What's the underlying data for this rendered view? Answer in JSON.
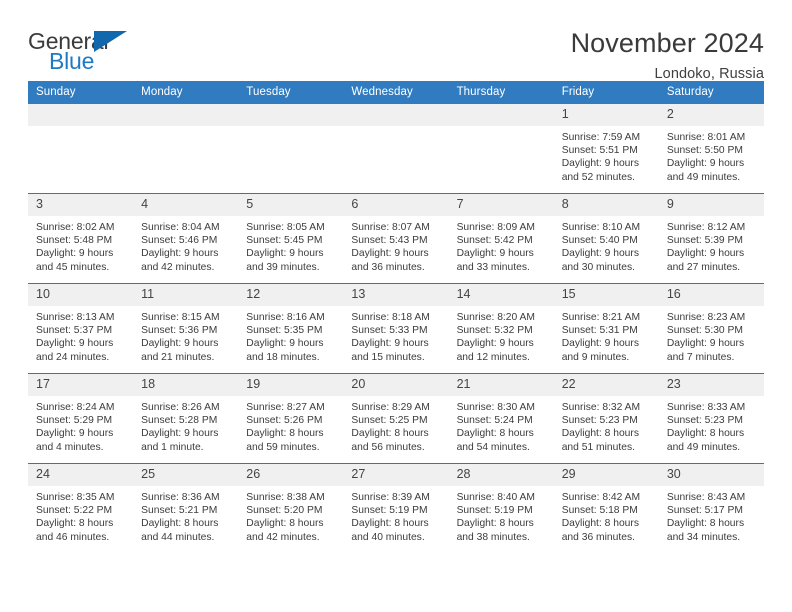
{
  "logo": {
    "word_one": "General",
    "word_two": "Blue",
    "flag_icon": "triangle-flag-icon"
  },
  "header": {
    "title": "November 2024",
    "location": "Londoko, Russia"
  },
  "colors": {
    "header_blue": "#317cc0",
    "row_divider": "#2f78ba",
    "daynum_band": "#f0f0f0",
    "logo_blue": "#1f7ac4",
    "text": "#3c3c3c"
  },
  "calendar": {
    "weekday_headers": [
      "Sunday",
      "Monday",
      "Tuesday",
      "Wednesday",
      "Thursday",
      "Friday",
      "Saturday"
    ],
    "labels": {
      "sunrise_prefix": "Sunrise:",
      "sunset_prefix": "Sunset:",
      "daylight_prefix": "Daylight:"
    },
    "weeks": [
      [
        {
          "day": "",
          "empty": true
        },
        {
          "day": "",
          "empty": true
        },
        {
          "day": "",
          "empty": true
        },
        {
          "day": "",
          "empty": true
        },
        {
          "day": "",
          "empty": true
        },
        {
          "day": "1",
          "sunrise": "Sunrise: 7:59 AM",
          "sunset": "Sunset: 5:51 PM",
          "daylight_line1": "Daylight: 9 hours",
          "daylight_line2": "and 52 minutes."
        },
        {
          "day": "2",
          "sunrise": "Sunrise: 8:01 AM",
          "sunset": "Sunset: 5:50 PM",
          "daylight_line1": "Daylight: 9 hours",
          "daylight_line2": "and 49 minutes."
        }
      ],
      [
        {
          "day": "3",
          "sunrise": "Sunrise: 8:02 AM",
          "sunset": "Sunset: 5:48 PM",
          "daylight_line1": "Daylight: 9 hours",
          "daylight_line2": "and 45 minutes."
        },
        {
          "day": "4",
          "sunrise": "Sunrise: 8:04 AM",
          "sunset": "Sunset: 5:46 PM",
          "daylight_line1": "Daylight: 9 hours",
          "daylight_line2": "and 42 minutes."
        },
        {
          "day": "5",
          "sunrise": "Sunrise: 8:05 AM",
          "sunset": "Sunset: 5:45 PM",
          "daylight_line1": "Daylight: 9 hours",
          "daylight_line2": "and 39 minutes."
        },
        {
          "day": "6",
          "sunrise": "Sunrise: 8:07 AM",
          "sunset": "Sunset: 5:43 PM",
          "daylight_line1": "Daylight: 9 hours",
          "daylight_line2": "and 36 minutes."
        },
        {
          "day": "7",
          "sunrise": "Sunrise: 8:09 AM",
          "sunset": "Sunset: 5:42 PM",
          "daylight_line1": "Daylight: 9 hours",
          "daylight_line2": "and 33 minutes."
        },
        {
          "day": "8",
          "sunrise": "Sunrise: 8:10 AM",
          "sunset": "Sunset: 5:40 PM",
          "daylight_line1": "Daylight: 9 hours",
          "daylight_line2": "and 30 minutes."
        },
        {
          "day": "9",
          "sunrise": "Sunrise: 8:12 AM",
          "sunset": "Sunset: 5:39 PM",
          "daylight_line1": "Daylight: 9 hours",
          "daylight_line2": "and 27 minutes."
        }
      ],
      [
        {
          "day": "10",
          "sunrise": "Sunrise: 8:13 AM",
          "sunset": "Sunset: 5:37 PM",
          "daylight_line1": "Daylight: 9 hours",
          "daylight_line2": "and 24 minutes."
        },
        {
          "day": "11",
          "sunrise": "Sunrise: 8:15 AM",
          "sunset": "Sunset: 5:36 PM",
          "daylight_line1": "Daylight: 9 hours",
          "daylight_line2": "and 21 minutes."
        },
        {
          "day": "12",
          "sunrise": "Sunrise: 8:16 AM",
          "sunset": "Sunset: 5:35 PM",
          "daylight_line1": "Daylight: 9 hours",
          "daylight_line2": "and 18 minutes."
        },
        {
          "day": "13",
          "sunrise": "Sunrise: 8:18 AM",
          "sunset": "Sunset: 5:33 PM",
          "daylight_line1": "Daylight: 9 hours",
          "daylight_line2": "and 15 minutes."
        },
        {
          "day": "14",
          "sunrise": "Sunrise: 8:20 AM",
          "sunset": "Sunset: 5:32 PM",
          "daylight_line1": "Daylight: 9 hours",
          "daylight_line2": "and 12 minutes."
        },
        {
          "day": "15",
          "sunrise": "Sunrise: 8:21 AM",
          "sunset": "Sunset: 5:31 PM",
          "daylight_line1": "Daylight: 9 hours",
          "daylight_line2": "and 9 minutes."
        },
        {
          "day": "16",
          "sunrise": "Sunrise: 8:23 AM",
          "sunset": "Sunset: 5:30 PM",
          "daylight_line1": "Daylight: 9 hours",
          "daylight_line2": "and 7 minutes."
        }
      ],
      [
        {
          "day": "17",
          "sunrise": "Sunrise: 8:24 AM",
          "sunset": "Sunset: 5:29 PM",
          "daylight_line1": "Daylight: 9 hours",
          "daylight_line2": "and 4 minutes."
        },
        {
          "day": "18",
          "sunrise": "Sunrise: 8:26 AM",
          "sunset": "Sunset: 5:28 PM",
          "daylight_line1": "Daylight: 9 hours",
          "daylight_line2": "and 1 minute."
        },
        {
          "day": "19",
          "sunrise": "Sunrise: 8:27 AM",
          "sunset": "Sunset: 5:26 PM",
          "daylight_line1": "Daylight: 8 hours",
          "daylight_line2": "and 59 minutes."
        },
        {
          "day": "20",
          "sunrise": "Sunrise: 8:29 AM",
          "sunset": "Sunset: 5:25 PM",
          "daylight_line1": "Daylight: 8 hours",
          "daylight_line2": "and 56 minutes."
        },
        {
          "day": "21",
          "sunrise": "Sunrise: 8:30 AM",
          "sunset": "Sunset: 5:24 PM",
          "daylight_line1": "Daylight: 8 hours",
          "daylight_line2": "and 54 minutes."
        },
        {
          "day": "22",
          "sunrise": "Sunrise: 8:32 AM",
          "sunset": "Sunset: 5:23 PM",
          "daylight_line1": "Daylight: 8 hours",
          "daylight_line2": "and 51 minutes."
        },
        {
          "day": "23",
          "sunrise": "Sunrise: 8:33 AM",
          "sunset": "Sunset: 5:23 PM",
          "daylight_line1": "Daylight: 8 hours",
          "daylight_line2": "and 49 minutes."
        }
      ],
      [
        {
          "day": "24",
          "sunrise": "Sunrise: 8:35 AM",
          "sunset": "Sunset: 5:22 PM",
          "daylight_line1": "Daylight: 8 hours",
          "daylight_line2": "and 46 minutes."
        },
        {
          "day": "25",
          "sunrise": "Sunrise: 8:36 AM",
          "sunset": "Sunset: 5:21 PM",
          "daylight_line1": "Daylight: 8 hours",
          "daylight_line2": "and 44 minutes."
        },
        {
          "day": "26",
          "sunrise": "Sunrise: 8:38 AM",
          "sunset": "Sunset: 5:20 PM",
          "daylight_line1": "Daylight: 8 hours",
          "daylight_line2": "and 42 minutes."
        },
        {
          "day": "27",
          "sunrise": "Sunrise: 8:39 AM",
          "sunset": "Sunset: 5:19 PM",
          "daylight_line1": "Daylight: 8 hours",
          "daylight_line2": "and 40 minutes."
        },
        {
          "day": "28",
          "sunrise": "Sunrise: 8:40 AM",
          "sunset": "Sunset: 5:19 PM",
          "daylight_line1": "Daylight: 8 hours",
          "daylight_line2": "and 38 minutes."
        },
        {
          "day": "29",
          "sunrise": "Sunrise: 8:42 AM",
          "sunset": "Sunset: 5:18 PM",
          "daylight_line1": "Daylight: 8 hours",
          "daylight_line2": "and 36 minutes."
        },
        {
          "day": "30",
          "sunrise": "Sunrise: 8:43 AM",
          "sunset": "Sunset: 5:17 PM",
          "daylight_line1": "Daylight: 8 hours",
          "daylight_line2": "and 34 minutes."
        }
      ]
    ]
  }
}
